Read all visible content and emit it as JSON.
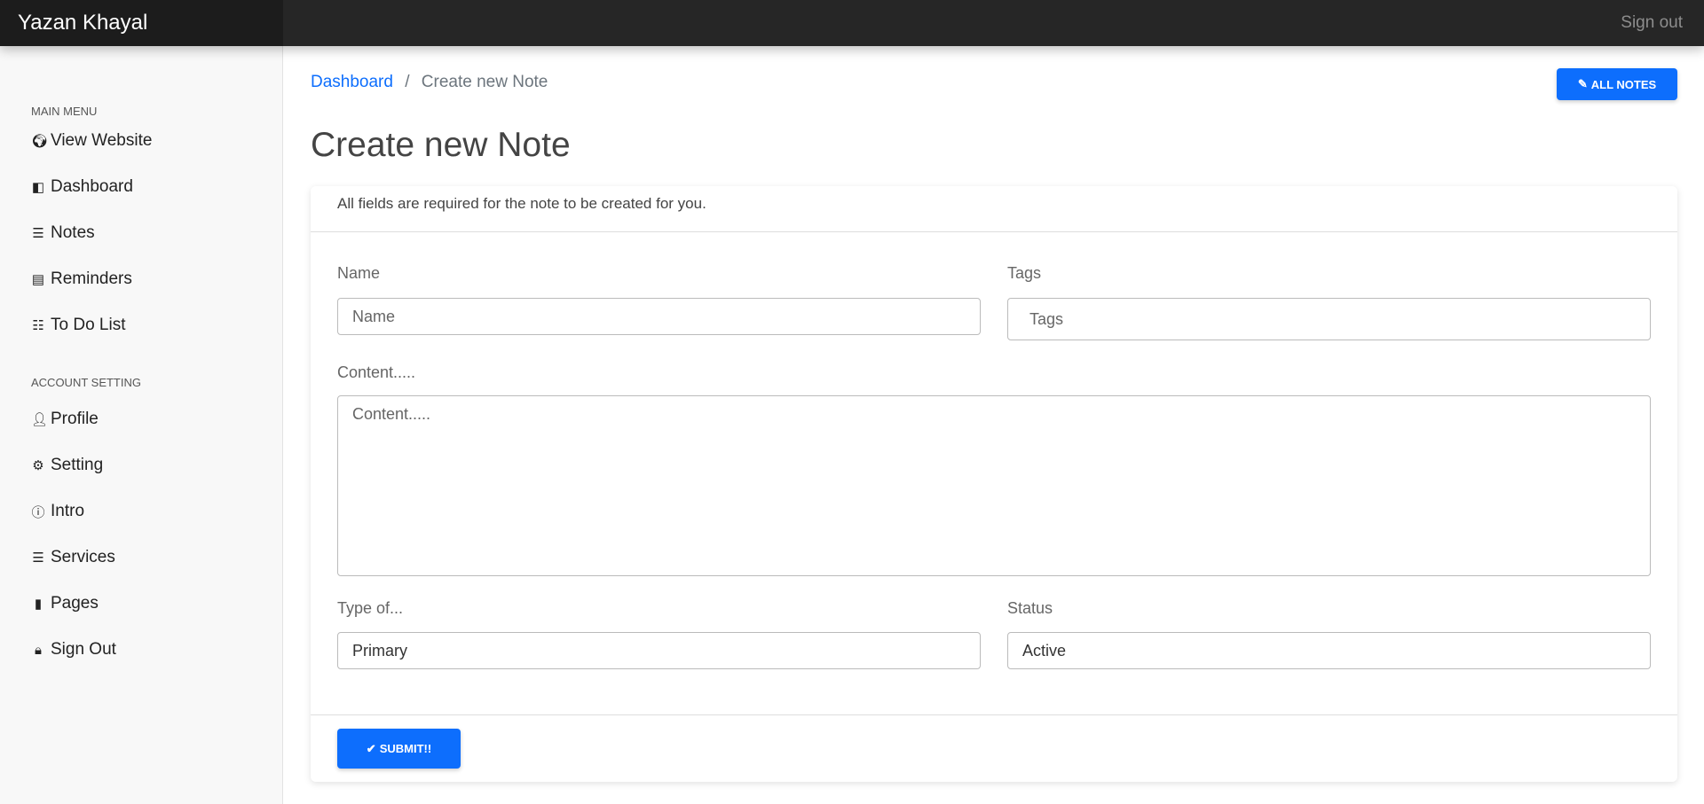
{
  "navbar": {
    "brand": "Yazan Khayal",
    "sign_out": "Sign out"
  },
  "sidebar": {
    "main_menu": "MAIN MENU",
    "main_items": [
      {
        "label": "View Website",
        "icon": "globe-icon"
      },
      {
        "label": "Dashboard",
        "icon": "dashboard-icon"
      },
      {
        "label": "Notes",
        "icon": "list-icon"
      },
      {
        "label": "Reminders",
        "icon": "list-alt-icon"
      },
      {
        "label": "To Do List",
        "icon": "ordered-list-icon"
      }
    ],
    "account_setting": "ACCOUNT SETTING",
    "account_items": [
      {
        "label": "Profile",
        "icon": "user-icon"
      },
      {
        "label": "Setting",
        "icon": "gears-icon"
      },
      {
        "label": "Intro",
        "icon": "info-icon"
      },
      {
        "label": "Services",
        "icon": "server-icon"
      },
      {
        "label": "Pages",
        "icon": "file-icon"
      },
      {
        "label": "Sign Out",
        "icon": "lock-icon"
      }
    ]
  },
  "breadcrumb": {
    "home": "Dashboard",
    "separator": "/",
    "current": "Create new Note"
  },
  "all_notes_button": "ALL NOTES",
  "page_title": "Create new Note",
  "form": {
    "header": "All fields are required for the note to be created for you.",
    "name": {
      "label": "Name",
      "placeholder": "Name"
    },
    "tags": {
      "label": "Tags",
      "placeholder": "Tags"
    },
    "content": {
      "label": "Content.....",
      "placeholder": "Content....."
    },
    "type": {
      "label": "Type of...",
      "value": "Primary"
    },
    "status": {
      "label": "Status",
      "value": "Active"
    },
    "submit": "SUBMIT!!"
  },
  "colors": {
    "primary": "#0d6efd",
    "navbar": "#262626"
  }
}
